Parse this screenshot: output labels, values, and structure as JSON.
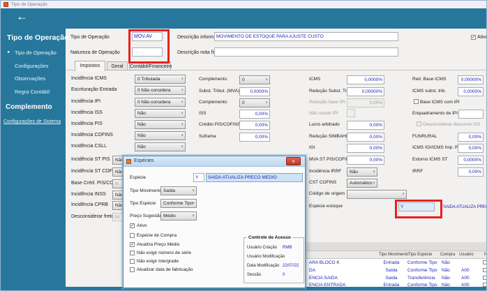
{
  "window": {
    "title": "Tipo de Operação"
  },
  "icons": {
    "back": "←",
    "close": "×",
    "chevron": "∨",
    "check": "✓",
    "bullet": "►"
  },
  "sidebar": {
    "title": "Tipo de Operação",
    "items": [
      {
        "label": "Tipo de Operação"
      },
      {
        "label": "Configurações"
      },
      {
        "label": "Observações"
      },
      {
        "label": "Regra Contábil"
      }
    ],
    "section": "Complemento",
    "link": "Configurações de Sistema"
  },
  "form": {
    "tipo_operacao": {
      "label": "Tipo de Operação",
      "value": "MOV.AV"
    },
    "natureza": {
      "label": "Natureza de Operação",
      "value": ". ."
    },
    "descricao_informativa": {
      "label": "Descrição informativa",
      "value": "MOVIMENTO DE ESTOQUE PARA AJUSTE CUSTO"
    },
    "descricao_nota": {
      "label": "Descrição nota fiscal",
      "value": ""
    },
    "ativo": {
      "label": "Ativo",
      "checked": true
    }
  },
  "tabs": [
    {
      "label": "Impostos"
    },
    {
      "label": "Geral"
    },
    {
      "label": "Contábil/Financeiro"
    }
  ],
  "impostos": {
    "col1": [
      {
        "label": "Incidência ICMS",
        "value": "0 Tributada"
      },
      {
        "label": "Escrituração Entrada",
        "value": "0 Não considera"
      },
      {
        "label": "Incidência IPI",
        "value": "0 Não considera"
      },
      {
        "label": "Incidência ISS",
        "value": "Não"
      },
      {
        "label": "Incidência PIS",
        "value": "Não"
      },
      {
        "label": "Incidência COFINS",
        "value": "Não"
      },
      {
        "label": "Incidência CSLL",
        "value": "Não"
      },
      {
        "label": "Incidência ST PIS",
        "value": "Não"
      },
      {
        "label": "Incidência ST COFINS",
        "value": "Não"
      },
      {
        "label": "Base Créd. PIS/COFINS",
        "value": "N"
      },
      {
        "label": "Incidência INSS",
        "value": "Não"
      },
      {
        "label": "Incidência CPRB",
        "value": "Não"
      },
      {
        "label": "Desconsiderar frete",
        "value": "00"
      }
    ],
    "col2": [
      {
        "label": "Complemento",
        "value": "0"
      },
      {
        "label": "Subst. Tribut. (MVA)",
        "value": "0,0000%"
      },
      {
        "label": "Complemento",
        "value": "0"
      },
      {
        "label": "ISS",
        "value": "0,00%"
      },
      {
        "label": "Crédito PIS/COFINS",
        "value": "0,00%"
      },
      {
        "label": "Suframa",
        "value": "0,00%"
      }
    ],
    "col3": [
      {
        "label": "ICMS",
        "value": "0,0000%"
      },
      {
        "label": "Redução Subst. Trib.",
        "value": "0,00000%"
      },
      {
        "label": "Redução base IPI",
        "value": "0,00%"
      },
      {
        "label": "Não somar IPI",
        "value": ""
      },
      {
        "label": "Lucro arbitrado",
        "value": "0,00%"
      },
      {
        "label": "Redução SIMBAHIA",
        "value": "0,00%"
      },
      {
        "label": "IGI",
        "value": "0,00%"
      },
      {
        "label": "MVA ST PIS/COFINS",
        "value": "0,00%"
      },
      {
        "label": "Incidência IRRF",
        "value": "Não"
      },
      {
        "label": "CST COFINS",
        "value": "Automático"
      },
      {
        "label": "Código de origem",
        "value": ""
      },
      {
        "label": "Espécie estoque",
        "value": "Y",
        "note": "SAIDA ATUALIZA PRECO MEDIO"
      }
    ],
    "col4": [
      {
        "label": "Red. Base ICMS",
        "value": "0,00000%"
      },
      {
        "label": "ICMS subst. trib.",
        "value": "0,0000%"
      },
      {
        "label": "Base ICMS com IPI",
        "checked": false
      },
      {
        "label": "Enquadramento de IPI",
        "value": ""
      },
      {
        "label": "Desconsiderar desconto ISS",
        "checked": false
      },
      {
        "label": "FUNRURAL",
        "value": "0,00%"
      },
      {
        "label": "ICMS IGI/ICMS Imp. PR",
        "value": "0,00%"
      },
      {
        "label": "Estorno ICMS ST",
        "value": "0,0000%"
      },
      {
        "label": "IRRF",
        "value": "0,00%"
      }
    ]
  },
  "dialog": {
    "title": "Espécies",
    "especie": {
      "label": "Espécie",
      "code": "Y",
      "value": "SAIDA ATUALIZA PRECO MEDIO"
    },
    "tipo_movimento": {
      "label": "Tipo Movimento",
      "value": "Saída"
    },
    "tipo_especie": {
      "label": "Tipo Espécie",
      "value": "Conforme Tipo"
    },
    "preco_sugestao": {
      "label": "Preço Sugestão",
      "value": "Médio"
    },
    "checkboxes": [
      {
        "label": "Ativo",
        "checked": true
      },
      {
        "label": "Espécie de Compra",
        "checked": false
      },
      {
        "label": "Atualiza Preço Médio",
        "checked": true
      },
      {
        "label": "Não exigir número de série",
        "checked": false
      },
      {
        "label": "Não exigir lote/grade",
        "checked": false
      },
      {
        "label": "Atualizar data de fabricação",
        "checked": false
      }
    ],
    "controle": {
      "title": "Controle de Acesso",
      "rows": [
        {
          "label": "Usuário Criação",
          "value": "RMB"
        },
        {
          "label": "Usuário Modificação",
          "value": ""
        },
        {
          "label": "Data Modificação",
          "value": "22/07/22"
        },
        {
          "label": "Sessão",
          "value": "0"
        }
      ]
    }
  },
  "table": {
    "headers": [
      "Tipo Movimento",
      "Tipo Espécie",
      "Compra",
      "Usuário",
      "N"
    ],
    "rows": [
      {
        "desc": "ARA BLOCO K",
        "movimento": "Entrada",
        "especie": "Conforme Tipo",
        "compra": "Não",
        "usuario": ""
      },
      {
        "desc": "DA",
        "movimento": "Saída",
        "especie": "Conforme Tipo",
        "compra": "Não",
        "usuario": "A00"
      },
      {
        "desc": "ENCIA SAIDA",
        "movimento": "Saída",
        "especie": "Transferência",
        "compra": "Não",
        "usuario": "A00"
      },
      {
        "desc": "ENCIA ENTRADA",
        "movimento": "Entrada",
        "especie": "Conforme Tipo",
        "compra": "Não",
        "usuario": "A00"
      }
    ]
  }
}
